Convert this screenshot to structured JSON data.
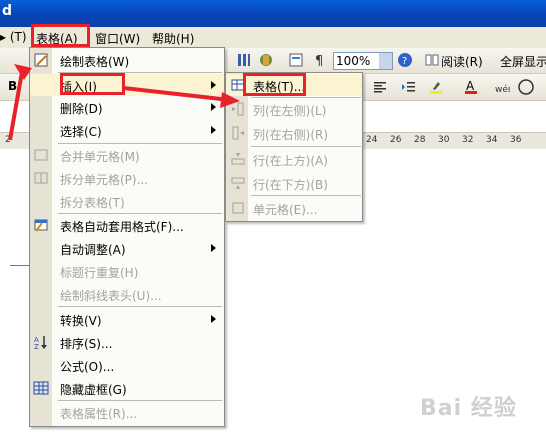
{
  "window": {
    "title": "d"
  },
  "menubar": {
    "items": [
      {
        "label": "▸ (T)"
      },
      {
        "label": "表格(A)"
      },
      {
        "label": "窗口(W)"
      },
      {
        "label": "帮助(H)"
      }
    ]
  },
  "toolbar": {
    "zoom_value": "100%",
    "read_label": "阅读(R)",
    "fullscreen_label": "全屏显示",
    "font_initial": "B"
  },
  "ruler": {
    "ticks": [
      "2",
      "24",
      "26",
      "28",
      "30",
      "32",
      "34",
      "36"
    ]
  },
  "table_menu": {
    "items": [
      {
        "label": "绘制表格(W)",
        "enabled": true
      },
      {
        "label": "插入(I)",
        "enabled": true,
        "submenu": true,
        "highlighted": true
      },
      {
        "label": "删除(D)",
        "enabled": true,
        "submenu": true
      },
      {
        "label": "选择(C)",
        "enabled": true,
        "submenu": true
      },
      {
        "label": "合并单元格(M)",
        "enabled": false
      },
      {
        "label": "拆分单元格(P)...",
        "enabled": false
      },
      {
        "label": "拆分表格(T)",
        "enabled": false
      },
      {
        "label": "表格自动套用格式(F)...",
        "enabled": true
      },
      {
        "label": "自动调整(A)",
        "enabled": true,
        "submenu": true
      },
      {
        "label": "标题行重复(H)",
        "enabled": false
      },
      {
        "label": "绘制斜线表头(U)...",
        "enabled": false
      },
      {
        "label": "转换(V)",
        "enabled": true,
        "submenu": true
      },
      {
        "label": "排序(S)...",
        "enabled": true
      },
      {
        "label": "公式(O)...",
        "enabled": true
      },
      {
        "label": "隐藏虚框(G)",
        "enabled": true
      },
      {
        "label": "表格属性(R)...",
        "enabled": false
      }
    ]
  },
  "insert_submenu": {
    "items": [
      {
        "label": "表格(T)...",
        "enabled": true,
        "highlighted": true
      },
      {
        "label": "列(在左侧)(L)",
        "enabled": false
      },
      {
        "label": "列(在右侧)(R)",
        "enabled": false
      },
      {
        "label": "行(在上方)(A)",
        "enabled": false
      },
      {
        "label": "行(在下方)(B)",
        "enabled": false
      },
      {
        "label": "单元格(E)...",
        "enabled": false
      }
    ]
  },
  "watermark": "Bai 经验",
  "colors": {
    "highlight_red": "#e8212a",
    "menu_hover": "#fbf3d2",
    "titlebar": "#0a4fc8"
  }
}
